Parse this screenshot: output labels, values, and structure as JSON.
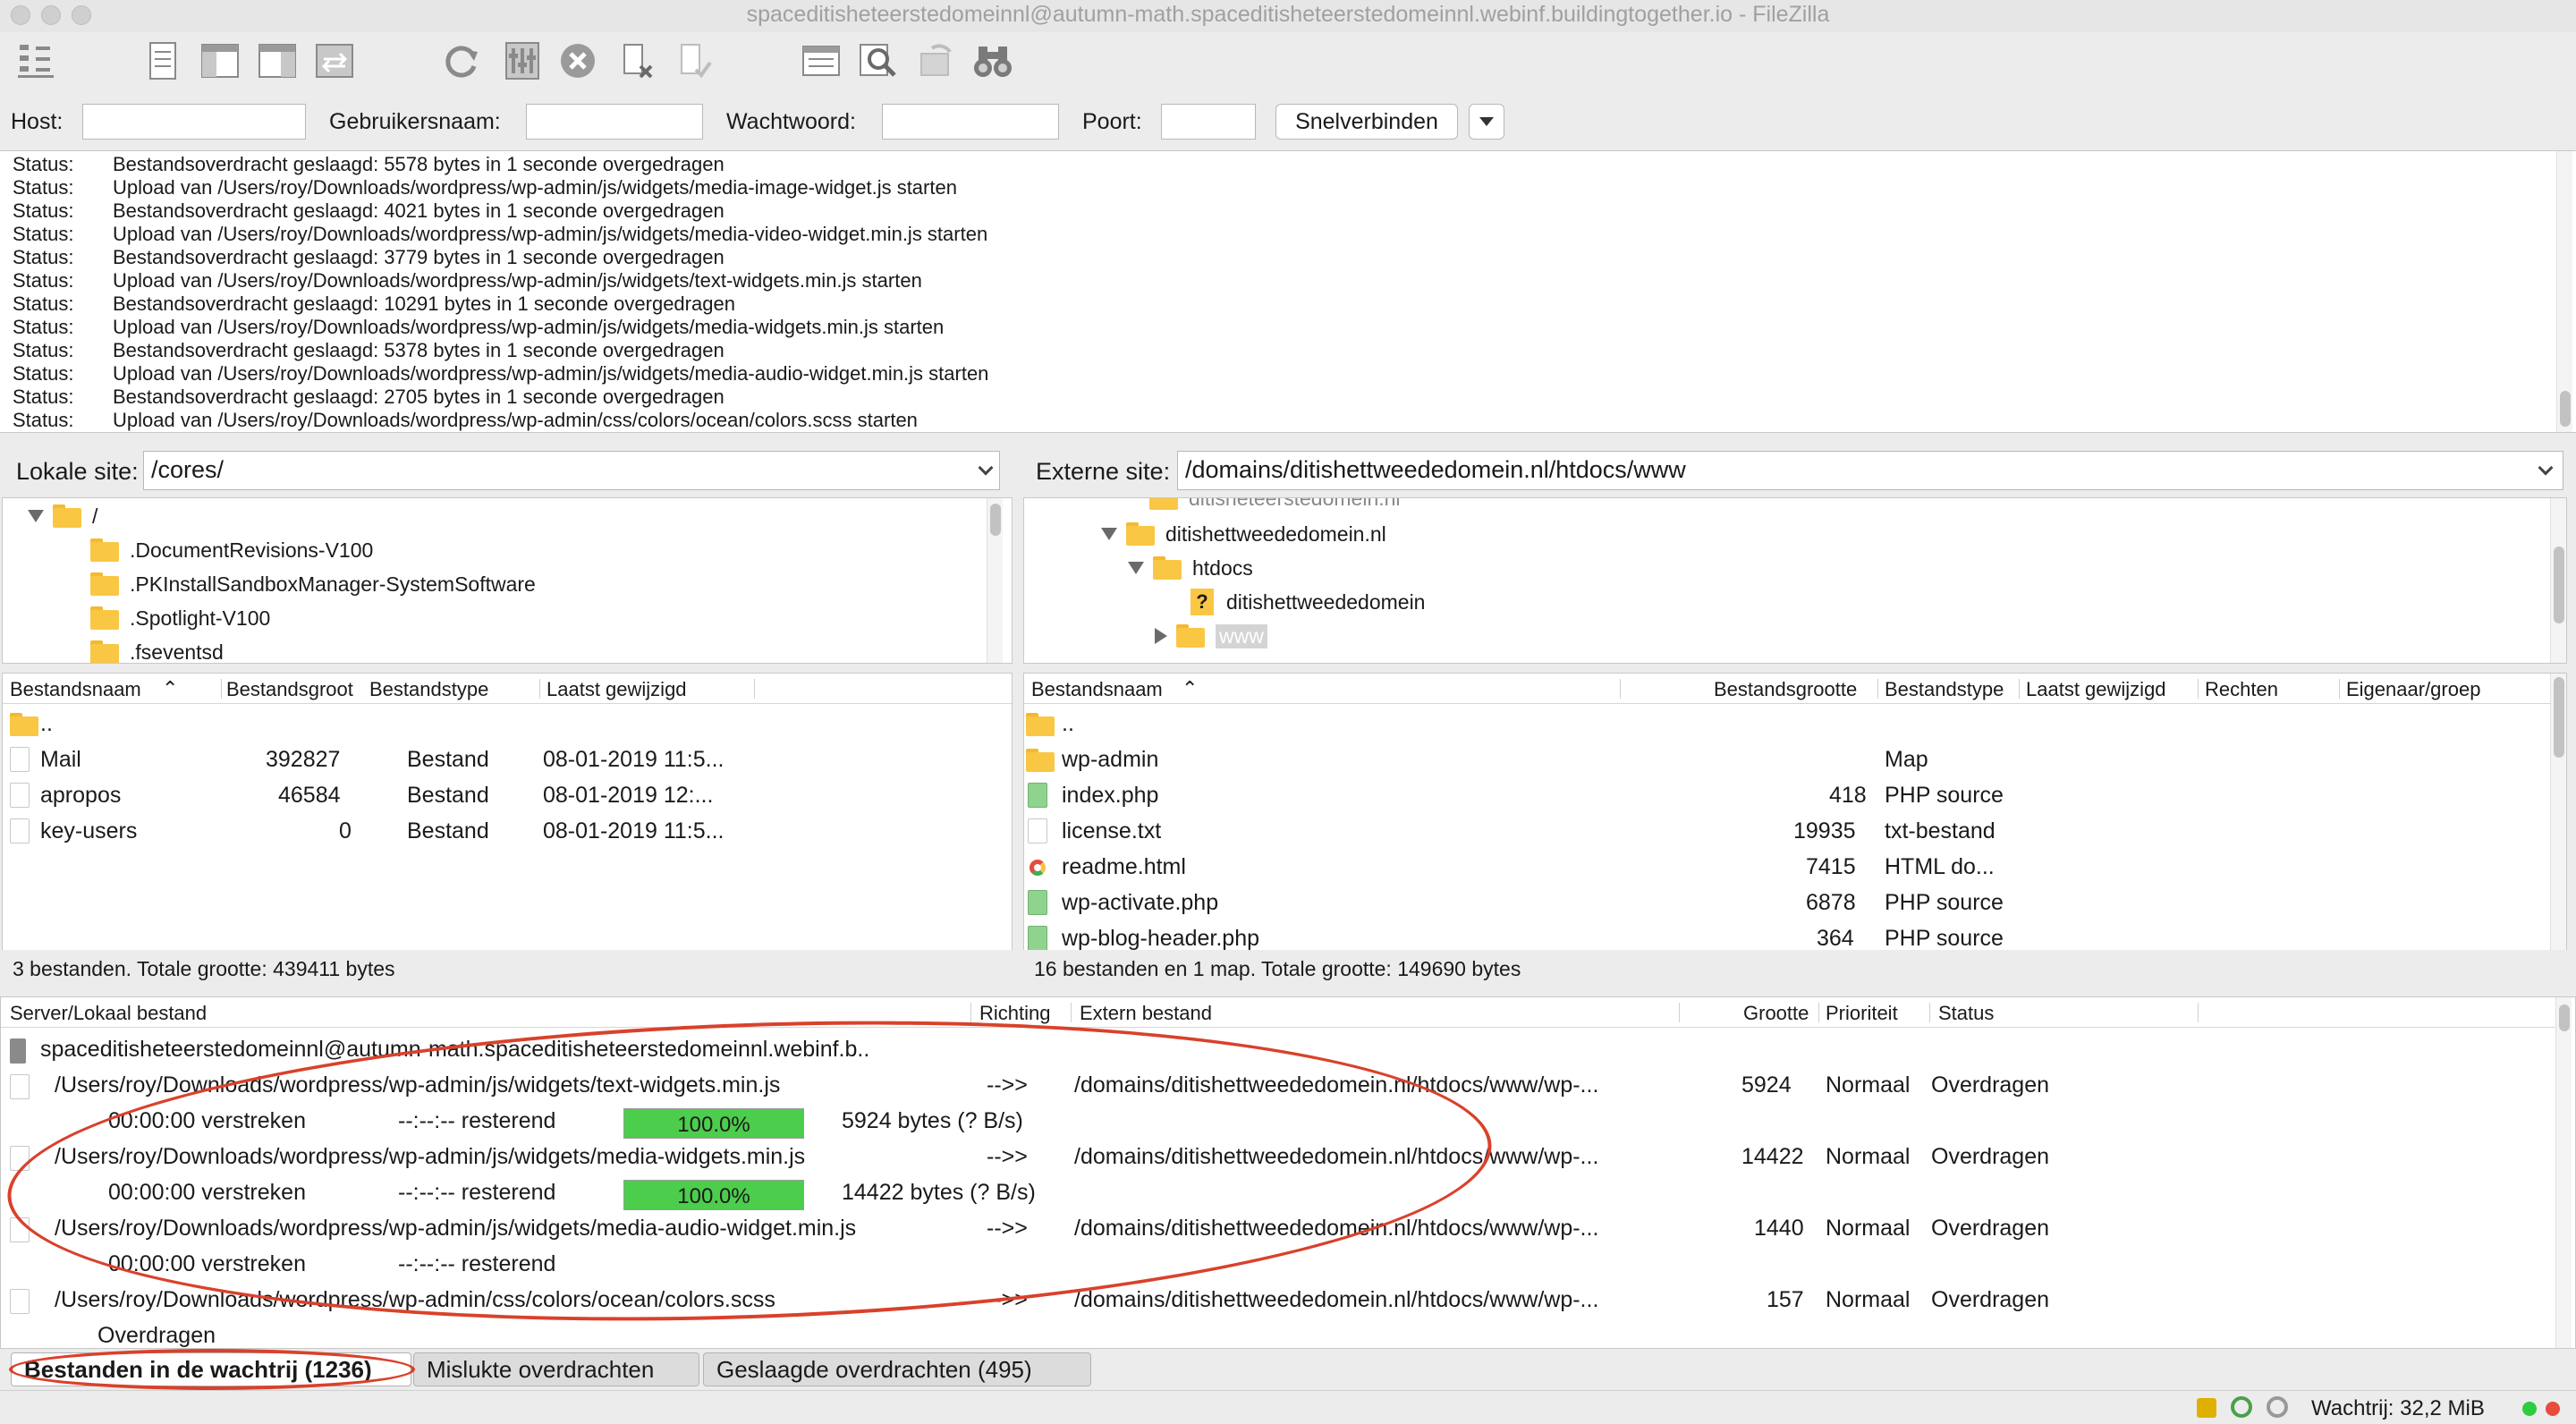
{
  "window": {
    "title": "spaceditisheteerstedomeinnl@autumn-math.spaceditisheteerstedomeinnl.webinf.buildingtogether.io - FileZilla"
  },
  "toolbar": {
    "icons": [
      "site-manager-icon",
      "message-log-icon",
      "local-tree-icon",
      "remote-tree-icon",
      "transfer-queue-icon",
      "refresh-icon",
      "filter-icon",
      "cancel-icon",
      "disconnect-icon",
      "reconnect-icon",
      "directory-listing-icon",
      "search-remote-icon",
      "synchronized-browsing-icon",
      "binoculars-icon"
    ]
  },
  "quickconnect": {
    "host_label": "Host:",
    "user_label": "Gebruikersnaam:",
    "pass_label": "Wachtwoord:",
    "port_label": "Poort:",
    "host_value": "",
    "user_value": "",
    "pass_value": "",
    "port_value": "",
    "connect_label": "Snelverbinden"
  },
  "log": {
    "lines": [
      {
        "label": "Status:",
        "message": "Bestandsoverdracht geslaagd: 5578 bytes in 1 seconde overgedragen"
      },
      {
        "label": "Status:",
        "message": "Upload van /Users/roy/Downloads/wordpress/wp-admin/js/widgets/media-image-widget.js starten"
      },
      {
        "label": "Status:",
        "message": "Bestandsoverdracht geslaagd: 4021 bytes in 1 seconde overgedragen"
      },
      {
        "label": "Status:",
        "message": "Upload van /Users/roy/Downloads/wordpress/wp-admin/js/widgets/media-video-widget.min.js starten"
      },
      {
        "label": "Status:",
        "message": "Bestandsoverdracht geslaagd: 3779 bytes in 1 seconde overgedragen"
      },
      {
        "label": "Status:",
        "message": "Upload van /Users/roy/Downloads/wordpress/wp-admin/js/widgets/text-widgets.min.js starten"
      },
      {
        "label": "Status:",
        "message": "Bestandsoverdracht geslaagd: 10291 bytes in 1 seconde overgedragen"
      },
      {
        "label": "Status:",
        "message": "Upload van /Users/roy/Downloads/wordpress/wp-admin/js/widgets/media-widgets.min.js starten"
      },
      {
        "label": "Status:",
        "message": "Bestandsoverdracht geslaagd: 5378 bytes in 1 seconde overgedragen"
      },
      {
        "label": "Status:",
        "message": "Upload van /Users/roy/Downloads/wordpress/wp-admin/js/widgets/media-audio-widget.min.js starten"
      },
      {
        "label": "Status:",
        "message": "Bestandsoverdracht geslaagd: 2705 bytes in 1 seconde overgedragen"
      },
      {
        "label": "Status:",
        "message": "Upload van /Users/roy/Downloads/wordpress/wp-admin/css/colors/ocean/colors.scss starten"
      }
    ]
  },
  "local": {
    "site_label": "Lokale site:",
    "path": "/cores/",
    "tree": [
      "/",
      ".DocumentRevisions-V100",
      ".PKInstallSandboxManager-SystemSoftware",
      ".Spotlight-V100",
      ".fseventsd"
    ],
    "columns": [
      "Bestandsnaam",
      "Bestandsgroot",
      "Bestandstype",
      "Laatst gewijzigd"
    ],
    "parent": "..",
    "files": [
      {
        "name": "Mail",
        "size": "392827",
        "type": "Bestand",
        "modified": "08-01-2019 11:5..."
      },
      {
        "name": "apropos",
        "size": "46584",
        "type": "Bestand",
        "modified": "08-01-2019 12:..."
      },
      {
        "name": "key-users",
        "size": "0",
        "type": "Bestand",
        "modified": "08-01-2019 11:5..."
      }
    ],
    "status": "3 bestanden. Totale grootte: 439411 bytes"
  },
  "remote": {
    "site_label": "Externe site:",
    "path": "/domains/ditishettweededomein.nl/htdocs/www",
    "tree": [
      "ditisheteerstedomein.nl",
      "ditishettweededomein.nl",
      "htdocs",
      "ditishettweededomein",
      "www"
    ],
    "columns": [
      "Bestandsnaam",
      "Bestandsgrootte",
      "Bestandstype",
      "Laatst gewijzigd",
      "Rechten",
      "Eigenaar/groep"
    ],
    "parent": "..",
    "files": [
      {
        "name": "wp-admin",
        "size": "",
        "type": "Map"
      },
      {
        "name": "index.php",
        "size": "418",
        "type": "PHP source"
      },
      {
        "name": "license.txt",
        "size": "19935",
        "type": "txt-bestand"
      },
      {
        "name": "readme.html",
        "size": "7415",
        "type": "HTML do..."
      },
      {
        "name": "wp-activate.php",
        "size": "6878",
        "type": "PHP source"
      },
      {
        "name": "wp-blog-header.php",
        "size": "364",
        "type": "PHP source"
      }
    ],
    "status": "16 bestanden en 1 map. Totale grootte: 149690 bytes"
  },
  "queue": {
    "columns": [
      "Server/Lokaal bestand",
      "Richting",
      "Extern bestand",
      "Grootte",
      "Prioriteit",
      "Status"
    ],
    "server": "spaceditisheteerstedomeinnl@autumn-math.spaceditisheteerstedomeinnl.webinf.b..",
    "items": [
      {
        "local": "/Users/roy/Downloads/wordpress/wp-admin/js/widgets/text-widgets.min.js",
        "direction": "-->>",
        "remote": "/domains/ditishettweededomein.nl/htdocs/www/wp-...",
        "size": "5924",
        "priority": "Normaal",
        "status": "Overdragen",
        "elapsed": "00:00:00 verstreken",
        "remaining": "--:--:-- resterend",
        "progress": 100,
        "progress_label": "100.0%",
        "bytes": "5924 bytes (? B/s)"
      },
      {
        "local": "/Users/roy/Downloads/wordpress/wp-admin/js/widgets/media-widgets.min.js",
        "direction": "-->>",
        "remote": "/domains/ditishettweededomein.nl/htdocs/www/wp-...",
        "size": "14422",
        "priority": "Normaal",
        "status": "Overdragen",
        "elapsed": "00:00:00 verstreken",
        "remaining": "--:--:-- resterend",
        "progress": 100,
        "progress_label": "100.0%",
        "bytes": "14422 bytes (? B/s)"
      },
      {
        "local": "/Users/roy/Downloads/wordpress/wp-admin/js/widgets/media-audio-widget.min.js",
        "direction": "-->>",
        "remote": "/domains/ditishettweededomein.nl/htdocs/www/wp-...",
        "size": "1440",
        "priority": "Normaal",
        "status": "Overdragen",
        "elapsed": "00:00:00 verstreken",
        "remaining": "--:--:-- resterend"
      },
      {
        "local": "/Users/roy/Downloads/wordpress/wp-admin/css/colors/ocean/colors.scss",
        "direction": "-->>",
        "remote": "/domains/ditishettweededomein.nl/htdocs/www/wp-...",
        "size": "157",
        "priority": "Normaal",
        "status": "Overdragen"
      }
    ],
    "trailing_status": "Overdragen"
  },
  "tabs": [
    {
      "label": "Bestanden in de wachtrij (1236)",
      "active": true
    },
    {
      "label": "Mislukte overdrachten",
      "active": false
    },
    {
      "label": "Geslaagde overdrachten (495)",
      "active": false
    }
  ],
  "statusbar": {
    "queue_label": "Wachtrij: 32,2 MiB"
  },
  "colors": {
    "annotation": "#d9412b",
    "progress": "#4ccd4c",
    "folder": "#f9c743"
  }
}
